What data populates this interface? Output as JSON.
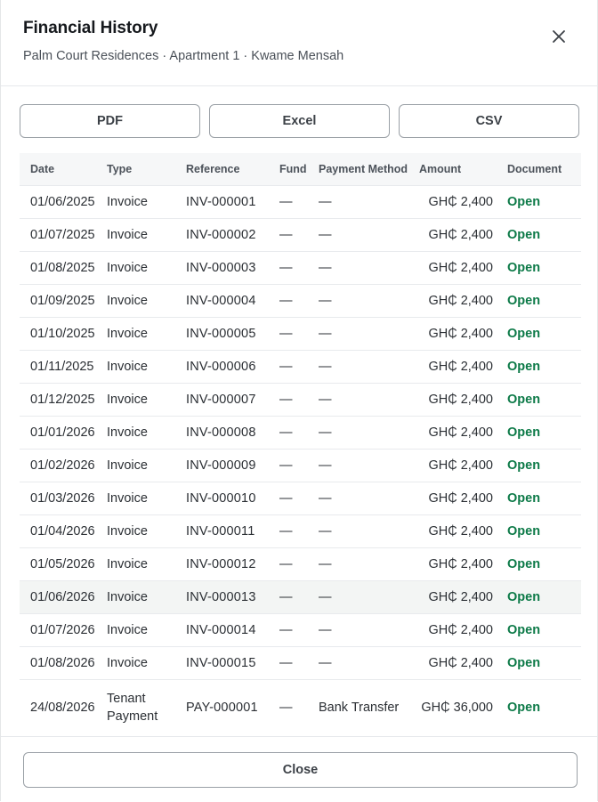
{
  "dialog": {
    "title": "Financial History",
    "subtitle": "Palm Court Residences · Apartment 1 · Kwame Mensah",
    "close_icon": "close-icon"
  },
  "export": {
    "pdf": "PDF",
    "excel": "Excel",
    "csv": "CSV"
  },
  "table": {
    "headers": {
      "date": "Date",
      "type": "Type",
      "reference": "Reference",
      "fund": "Fund",
      "payment_method": "Payment Method",
      "amount": "Amount",
      "document": "Document"
    },
    "rows": [
      {
        "date": "01/06/2025",
        "type": "Invoice",
        "reference": "INV-000001",
        "fund": "—",
        "payment_method": "—",
        "amount": "GH₵ 2,400",
        "document": "Open"
      },
      {
        "date": "01/07/2025",
        "type": "Invoice",
        "reference": "INV-000002",
        "fund": "—",
        "payment_method": "—",
        "amount": "GH₵ 2,400",
        "document": "Open"
      },
      {
        "date": "01/08/2025",
        "type": "Invoice",
        "reference": "INV-000003",
        "fund": "—",
        "payment_method": "—",
        "amount": "GH₵ 2,400",
        "document": "Open"
      },
      {
        "date": "01/09/2025",
        "type": "Invoice",
        "reference": "INV-000004",
        "fund": "—",
        "payment_method": "—",
        "amount": "GH₵ 2,400",
        "document": "Open"
      },
      {
        "date": "01/10/2025",
        "type": "Invoice",
        "reference": "INV-000005",
        "fund": "—",
        "payment_method": "—",
        "amount": "GH₵ 2,400",
        "document": "Open"
      },
      {
        "date": "01/11/2025",
        "type": "Invoice",
        "reference": "INV-000006",
        "fund": "—",
        "payment_method": "—",
        "amount": "GH₵ 2,400",
        "document": "Open"
      },
      {
        "date": "01/12/2025",
        "type": "Invoice",
        "reference": "INV-000007",
        "fund": "—",
        "payment_method": "—",
        "amount": "GH₵ 2,400",
        "document": "Open"
      },
      {
        "date": "01/01/2026",
        "type": "Invoice",
        "reference": "INV-000008",
        "fund": "—",
        "payment_method": "—",
        "amount": "GH₵ 2,400",
        "document": "Open"
      },
      {
        "date": "01/02/2026",
        "type": "Invoice",
        "reference": "INV-000009",
        "fund": "—",
        "payment_method": "—",
        "amount": "GH₵ 2,400",
        "document": "Open"
      },
      {
        "date": "01/03/2026",
        "type": "Invoice",
        "reference": "INV-000010",
        "fund": "—",
        "payment_method": "—",
        "amount": "GH₵ 2,400",
        "document": "Open"
      },
      {
        "date": "01/04/2026",
        "type": "Invoice",
        "reference": "INV-000011",
        "fund": "—",
        "payment_method": "—",
        "amount": "GH₵ 2,400",
        "document": "Open"
      },
      {
        "date": "01/05/2026",
        "type": "Invoice",
        "reference": "INV-000012",
        "fund": "—",
        "payment_method": "—",
        "amount": "GH₵ 2,400",
        "document": "Open"
      },
      {
        "date": "01/06/2026",
        "type": "Invoice",
        "reference": "INV-000013",
        "fund": "—",
        "payment_method": "—",
        "amount": "GH₵ 2,400",
        "document": "Open"
      },
      {
        "date": "01/07/2026",
        "type": "Invoice",
        "reference": "INV-000014",
        "fund": "—",
        "payment_method": "—",
        "amount": "GH₵ 2,400",
        "document": "Open"
      },
      {
        "date": "01/08/2026",
        "type": "Invoice",
        "reference": "INV-000015",
        "fund": "—",
        "payment_method": "—",
        "amount": "GH₵ 2,400",
        "document": "Open"
      },
      {
        "date": "24/08/2026",
        "type": "Tenant Payment",
        "reference": "PAY-000001",
        "fund": "—",
        "payment_method": "Bank Transfer",
        "amount": "GH₵ 36,000",
        "document": "Open"
      }
    ]
  },
  "footer": {
    "close_label": "Close"
  },
  "colors": {
    "link_green": "#0d7a48",
    "hover_row": "#f3f5f4"
  }
}
